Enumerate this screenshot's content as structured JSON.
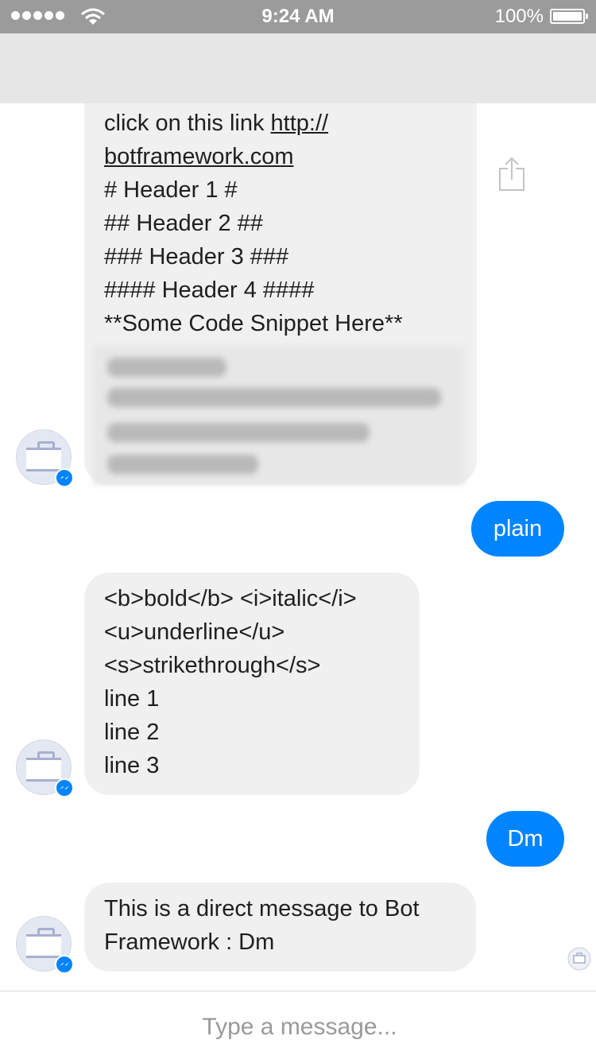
{
  "status_bar": {
    "time": "9:24 AM",
    "battery": "100%"
  },
  "messages": {
    "m1": {
      "lines": [
        "click on this link ",
        "http://",
        "botframework.com",
        "# Header 1 #",
        "## Header 2 ##",
        "### Header 3 ###",
        "#### Header 4 ####",
        "**Some Code Snippet Here**"
      ]
    },
    "m2": {
      "text": "plain"
    },
    "m3": {
      "lines": [
        "<b>bold</b> <i>italic</i>",
        "<u>underline</u>",
        "<s>strikethrough</s>",
        "line 1",
        "line 2",
        "line 3"
      ]
    },
    "m4": {
      "text": "Dm"
    },
    "m5": {
      "lines": [
        "This is a direct message to Bot",
        "Framework : Dm"
      ]
    }
  },
  "composer": {
    "placeholder": "Type a message..."
  },
  "icons": {
    "signal": "signal-dots-icon",
    "wifi": "wifi-icon",
    "battery": "battery-icon",
    "share": "share-icon",
    "bot_avatar": "briefcase-icon",
    "messenger_badge": "messenger-icon"
  },
  "colors": {
    "status_bar": "#9b9b9b",
    "nav_bar": "#e6e6e6",
    "incoming_bubble": "#f0f0f0",
    "outgoing_bubble": "#0084ff"
  }
}
